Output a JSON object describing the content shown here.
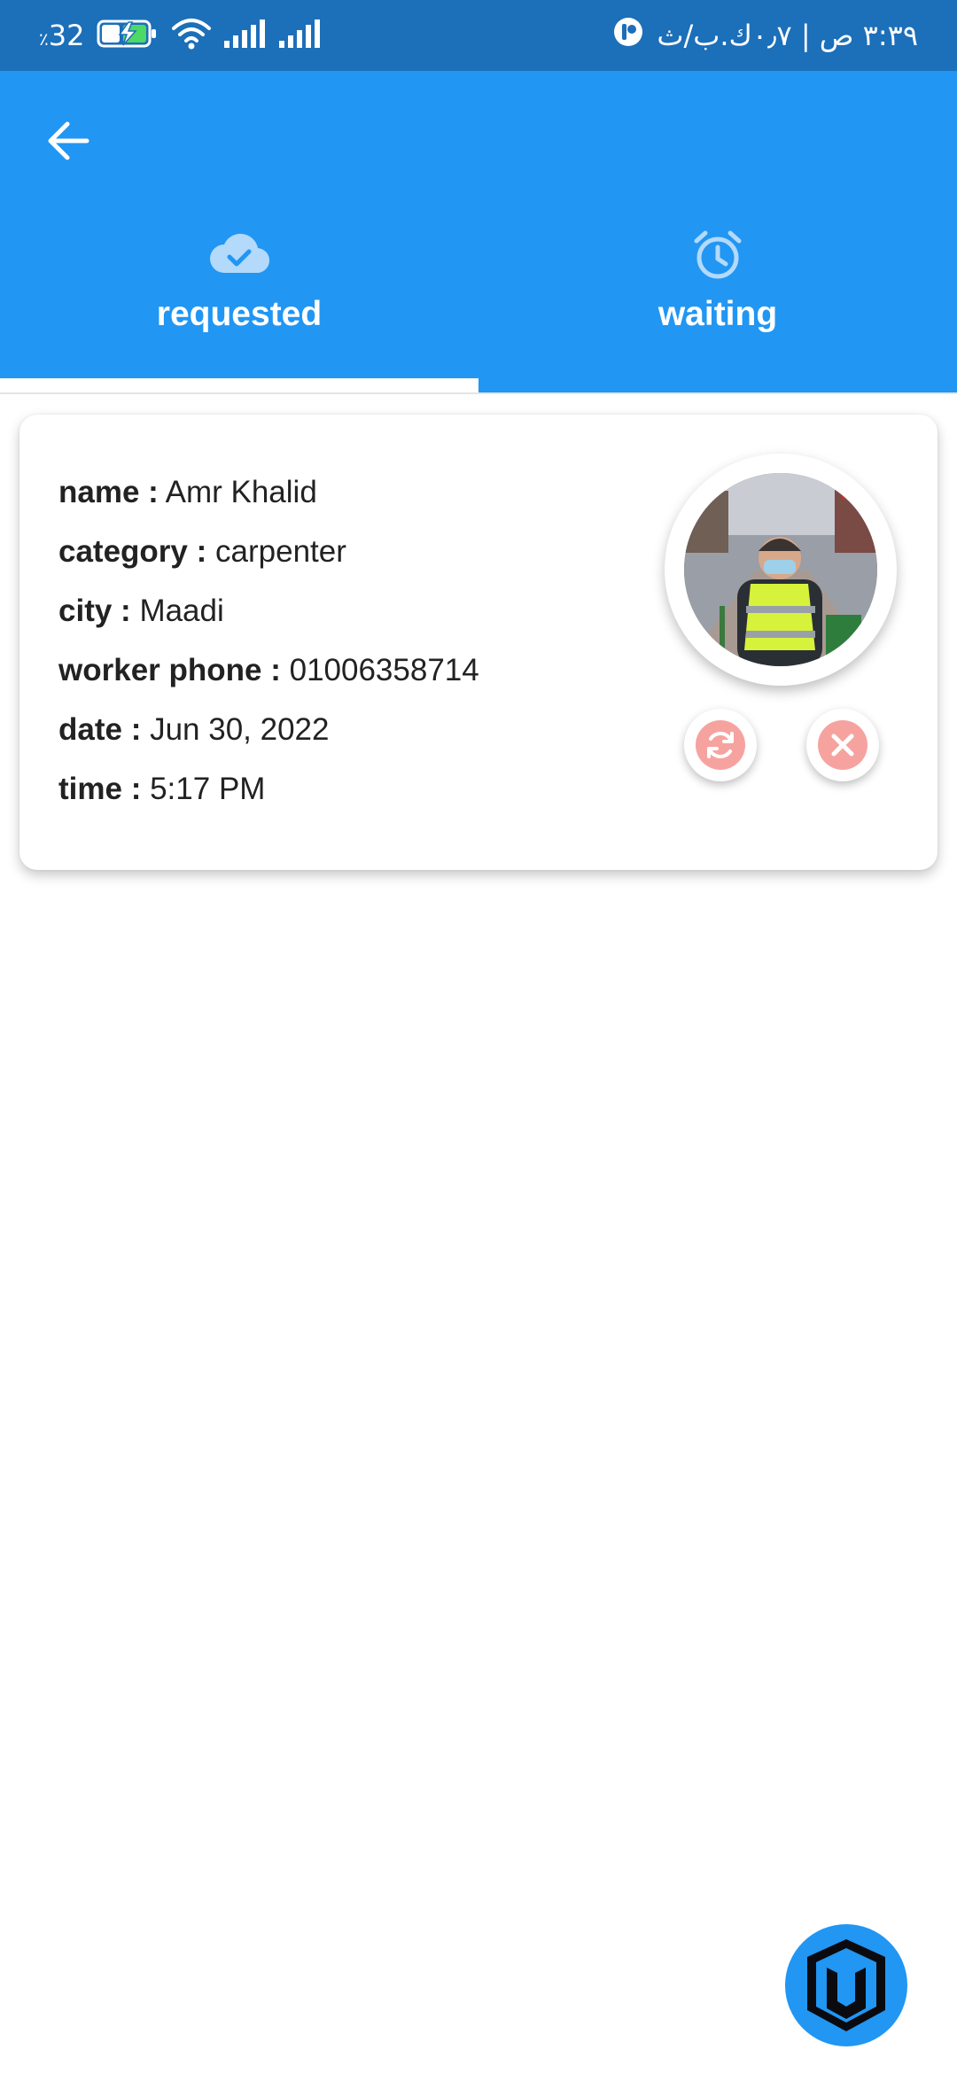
{
  "status_bar": {
    "battery": "32",
    "battery_symbol": "٪",
    "right_text": "٣:٣٩ ص | ٠٫٧ك.ب/ث"
  },
  "tabs": [
    {
      "label": "requested",
      "icon": "cloud-check-icon",
      "selected": true
    },
    {
      "label": "waiting",
      "icon": "alarm-clock-icon",
      "selected": false
    }
  ],
  "request": {
    "name_key": "name :",
    "name_value": "Amr Khalid",
    "category_key": "category :",
    "category_value": "carpenter",
    "city_key": "city :",
    "city_value": "Maadi",
    "phone_key": "worker phone :",
    "phone_value": "01006358714",
    "date_key": "date :",
    "date_value": "Jun 30, 2022",
    "time_key": "time :",
    "time_value": "5:17 PM"
  },
  "colors": {
    "status_bar": "#1c6fb9",
    "app_bar": "#2196f3",
    "action_button": "#f6a3a0"
  }
}
